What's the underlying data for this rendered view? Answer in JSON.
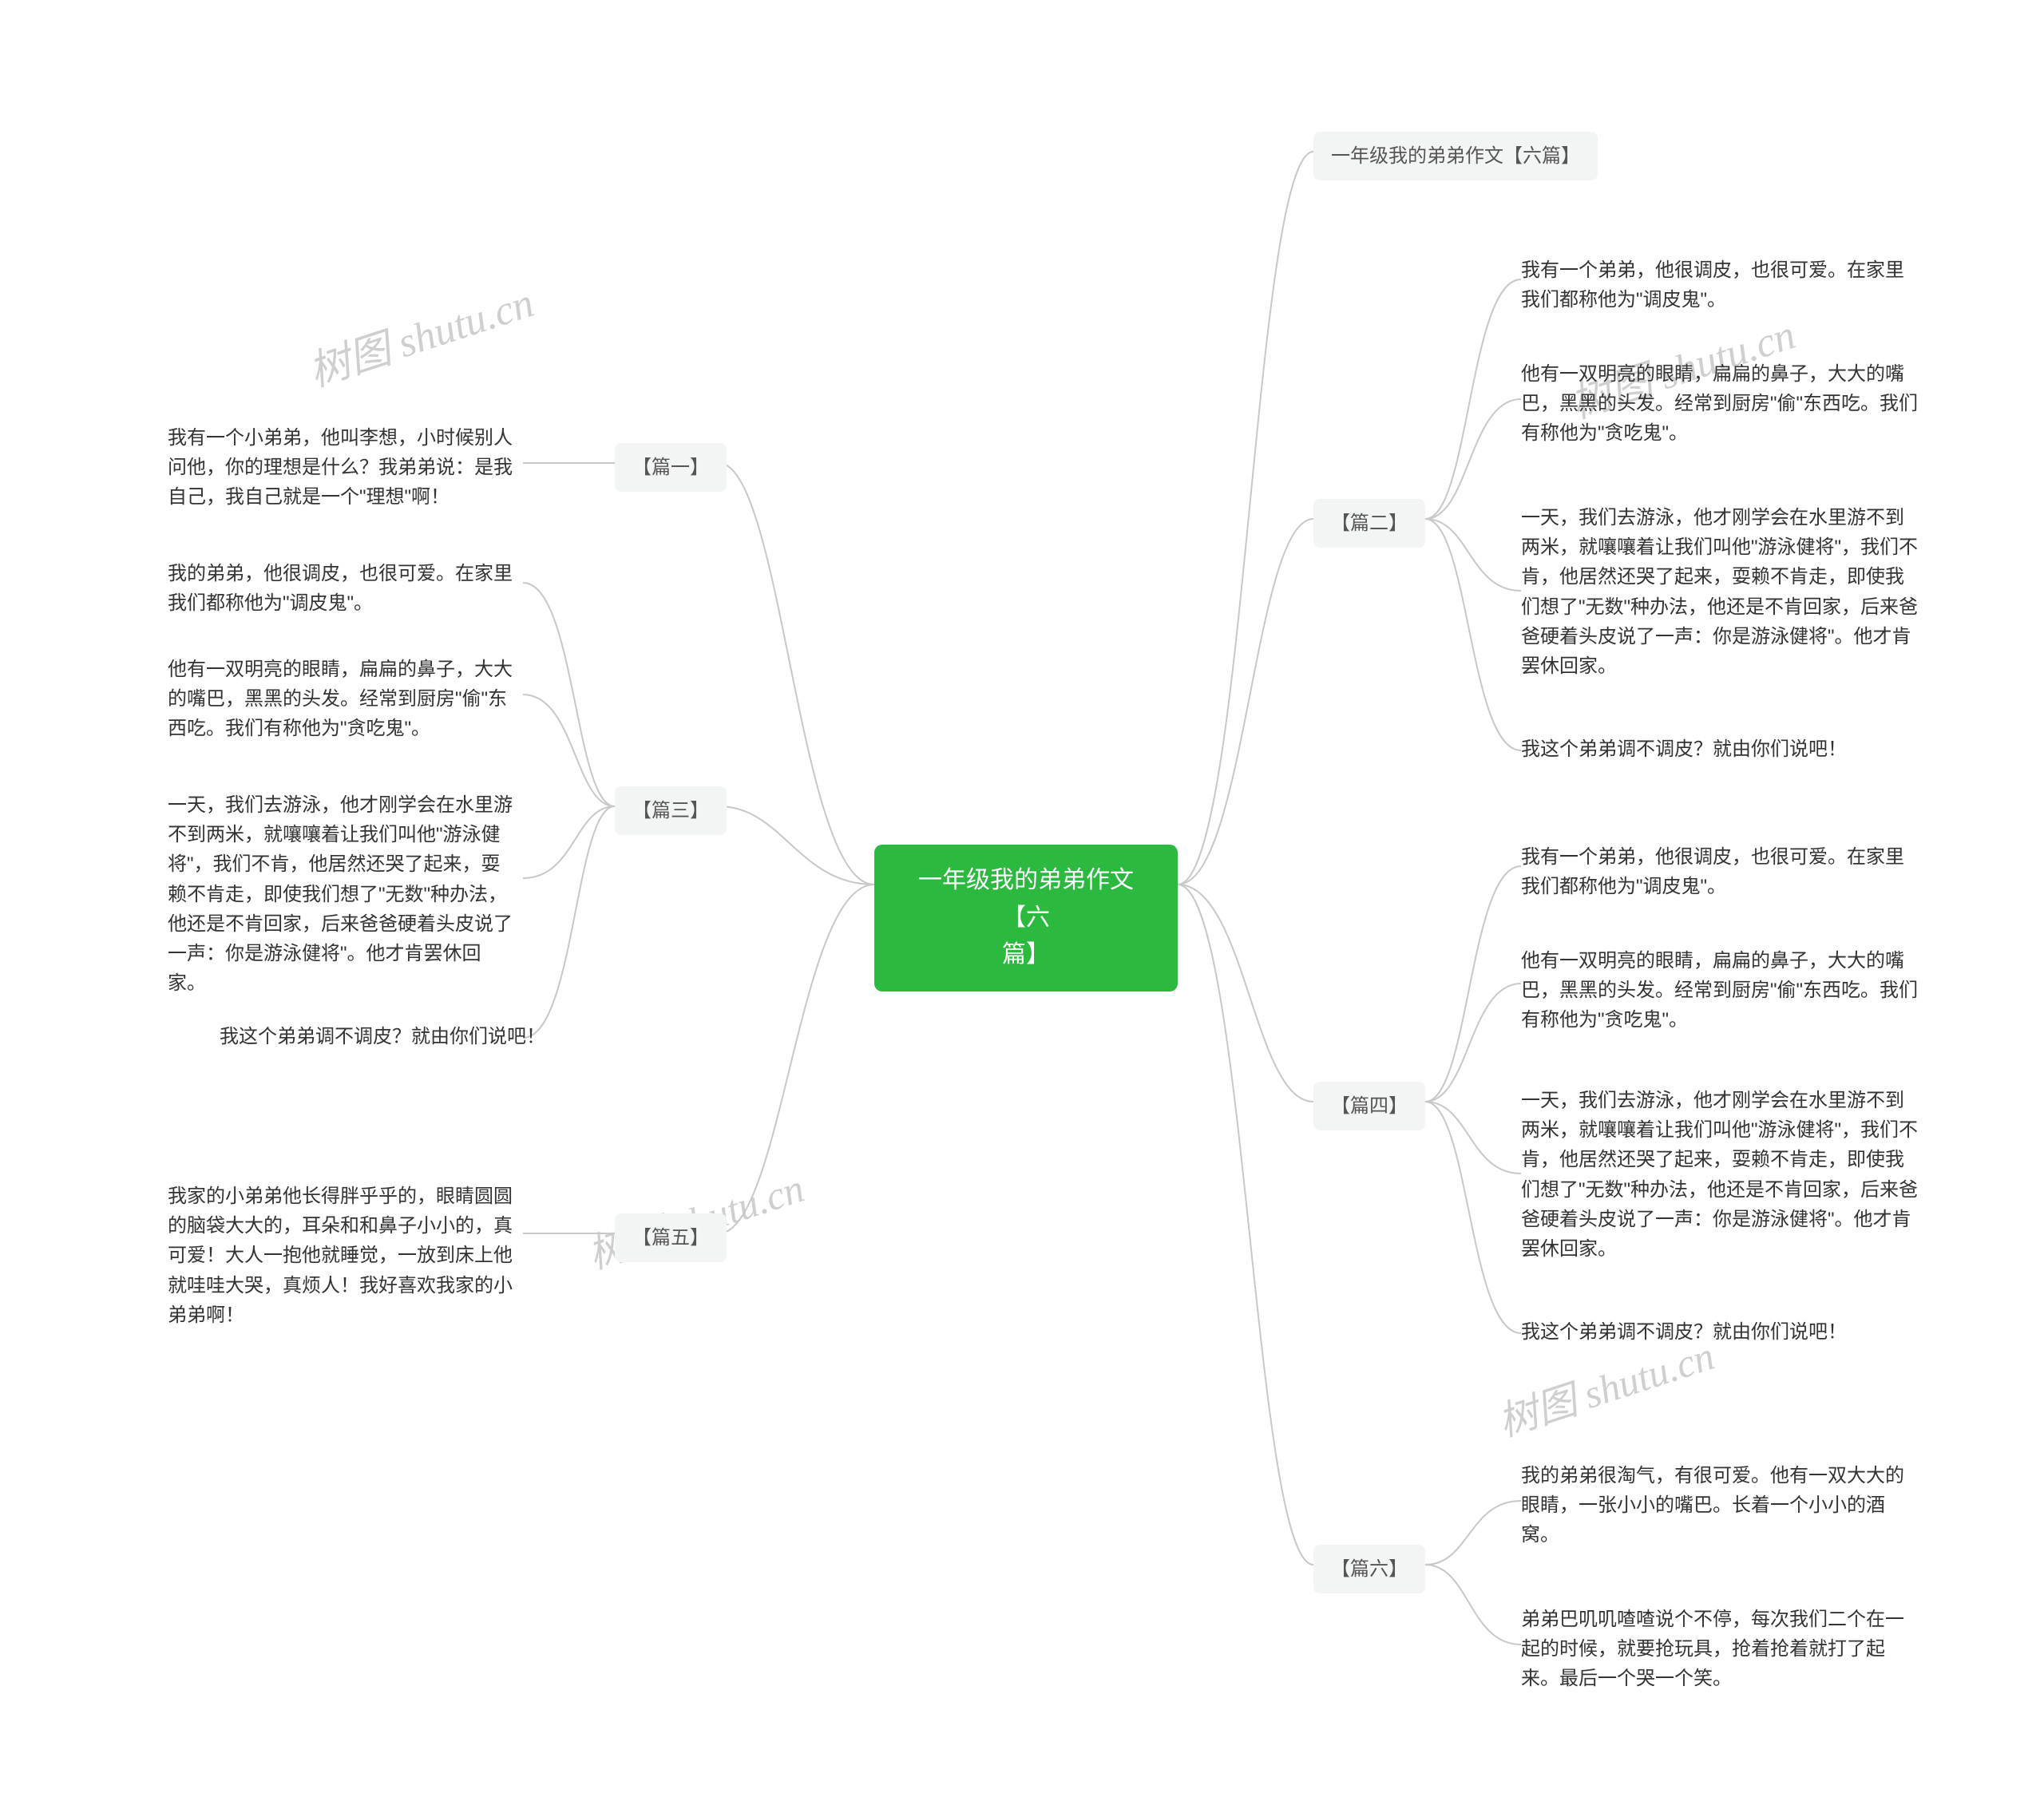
{
  "root": {
    "line1": "一年级我的弟弟作文【六",
    "line2": "篇】"
  },
  "right_title": "一年级我的弟弟作文【六篇】",
  "watermark": "树图 shutu.cn",
  "left": {
    "p1": {
      "label": "【篇一】",
      "t1": "我有一个小弟弟，他叫李想，小时候别人问他，你的理想是什么？我弟弟说：是我自己，我自己就是一个\"理想\"啊！"
    },
    "p3": {
      "label": "【篇三】",
      "t1": "我的弟弟，他很调皮，也很可爱。在家里我们都称他为\"调皮鬼\"。",
      "t2": "他有一双明亮的眼睛，扁扁的鼻子，大大的嘴巴，黑黑的头发。经常到厨房\"偷\"东西吃。我们有称他为\"贪吃鬼\"。",
      "t3": "一天，我们去游泳，他才刚学会在水里游不到两米，就嚷嚷着让我们叫他\"游泳健将\"，我们不肯，他居然还哭了起来，耍赖不肯走，即使我们想了\"无数\"种办法，他还是不肯回家，后来爸爸硬着头皮说了一声：你是游泳健将\"。他才肯罢休回家。",
      "t4": "我这个弟弟调不调皮？就由你们说吧！"
    },
    "p5": {
      "label": "【篇五】",
      "t1": "我家的小弟弟他长得胖乎乎的，眼睛圆圆的脑袋大大的，耳朵和和鼻子小小的，真可爱！大人一抱他就睡觉，一放到床上他就哇哇大哭，真烦人！我好喜欢我家的小弟弟啊！"
    }
  },
  "right": {
    "p2": {
      "label": "【篇二】",
      "t1": "我有一个弟弟，他很调皮，也很可爱。在家里我们都称他为\"调皮鬼\"。",
      "t2": "他有一双明亮的眼睛，扁扁的鼻子，大大的嘴巴，黑黑的头发。经常到厨房\"偷\"东西吃。我们有称他为\"贪吃鬼\"。",
      "t3": "一天，我们去游泳，他才刚学会在水里游不到两米，就嚷嚷着让我们叫他\"游泳健将\"，我们不肯，他居然还哭了起来，耍赖不肯走，即使我们想了\"无数\"种办法，他还是不肯回家，后来爸爸硬着头皮说了一声：你是游泳健将\"。他才肯罢休回家。",
      "t4": "我这个弟弟调不调皮？就由你们说吧！"
    },
    "p4": {
      "label": "【篇四】",
      "t1": "我有一个弟弟，他很调皮，也很可爱。在家里我们都称他为\"调皮鬼\"。",
      "t2": "他有一双明亮的眼睛，扁扁的鼻子，大大的嘴巴，黑黑的头发。经常到厨房\"偷\"东西吃。我们有称他为\"贪吃鬼\"。",
      "t3": "一天，我们去游泳，他才刚学会在水里游不到两米，就嚷嚷着让我们叫他\"游泳健将\"，我们不肯，他居然还哭了起来，耍赖不肯走，即使我们想了\"无数\"种办法，他还是不肯回家，后来爸爸硬着头皮说了一声：你是游泳健将\"。他才肯罢休回家。",
      "t4": "我这个弟弟调不调皮？就由你们说吧！"
    },
    "p6": {
      "label": "【篇六】",
      "t1": "我的弟弟很淘气，有很可爱。他有一双大大的眼睛，一张小小的嘴巴。长着一个小小的酒窝。",
      "t2": "弟弟巴叽叽喳喳说个不停，每次我们二个在一起的时候，就要抢玩具，抢着抢着就打了起来。最后一个哭一个笑。"
    }
  }
}
